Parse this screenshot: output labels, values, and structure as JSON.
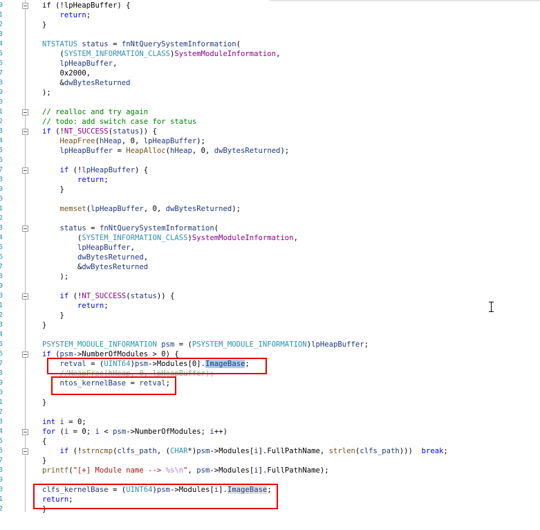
{
  "gutter_numbers": [
    "9",
    "1",
    "2",
    "3",
    "4",
    "5",
    "6",
    "7",
    "8",
    "9",
    "0",
    "1",
    "2",
    "3",
    "4",
    "5",
    "6",
    "7",
    "8",
    "9",
    "0",
    "1",
    "2",
    "3",
    "4",
    "5",
    "6",
    "7",
    "8",
    "9",
    "0",
    "1",
    "2",
    "3",
    "4",
    "5",
    "6",
    "7",
    "8",
    "9",
    "0",
    "1",
    "2",
    "3",
    "4",
    "5",
    "6",
    "7",
    "8",
    "9",
    "0",
    "1",
    "2"
  ],
  "colors": {
    "keyword": "#0000ff",
    "function": "#74531f",
    "variable": "#1f377f",
    "type": "#2b91af",
    "enum_member": "#8b008b",
    "comment": "#008000",
    "string": "#a31515",
    "selection_highlight": "#a8cde8",
    "annotation_box": "#e60000"
  },
  "code_lines": [
    [
      {
        "t": "if (!lpHeapBuffer) {",
        "c": "plain"
      }
    ],
    [
      {
        "t": "    ",
        "c": "plain"
      },
      {
        "t": "return",
        "c": "kw"
      },
      {
        "t": ";",
        "c": "plain"
      }
    ],
    [
      {
        "t": "}",
        "c": "plain"
      }
    ],
    [],
    [
      {
        "t": "NTSTATUS",
        "c": "type"
      },
      {
        "t": " ",
        "c": "plain"
      },
      {
        "t": "status",
        "c": "var"
      },
      {
        "t": " = ",
        "c": "plain"
      },
      {
        "t": "fnNtQuerySystemInformation",
        "c": "var"
      },
      {
        "t": "(",
        "c": "plain"
      }
    ],
    [
      {
        "t": "    (",
        "c": "plain"
      },
      {
        "t": "SYSTEM_INFORMATION_CLASS",
        "c": "type"
      },
      {
        "t": ")",
        "c": "plain"
      },
      {
        "t": "SystemModuleInformation",
        "c": "enum"
      },
      {
        "t": ",",
        "c": "plain"
      }
    ],
    [
      {
        "t": "    ",
        "c": "plain"
      },
      {
        "t": "lpHeapBuffer",
        "c": "var"
      },
      {
        "t": ",",
        "c": "plain"
      }
    ],
    [
      {
        "t": "    0x2000,",
        "c": "plain"
      }
    ],
    [
      {
        "t": "    &",
        "c": "plain"
      },
      {
        "t": "dwBytesReturned",
        "c": "var"
      }
    ],
    [
      {
        "t": ");",
        "c": "plain"
      }
    ],
    [],
    [
      {
        "t": "// realloc and try again",
        "c": "cm"
      }
    ],
    [
      {
        "t": "// todo: add switch case for status",
        "c": "cm"
      }
    ],
    [
      {
        "t": "if",
        "c": "kw"
      },
      {
        "t": " (!",
        "c": "plain"
      },
      {
        "t": "NT_SUCCESS",
        "c": "mac"
      },
      {
        "t": "(",
        "c": "plain"
      },
      {
        "t": "status",
        "c": "var"
      },
      {
        "t": ")) {",
        "c": "plain"
      }
    ],
    [
      {
        "t": "    ",
        "c": "plain"
      },
      {
        "t": "HeapFree",
        "c": "fn"
      },
      {
        "t": "(",
        "c": "plain"
      },
      {
        "t": "hHeap",
        "c": "var"
      },
      {
        "t": ", 0, ",
        "c": "plain"
      },
      {
        "t": "lpHeapBuffer",
        "c": "var"
      },
      {
        "t": ");",
        "c": "plain"
      }
    ],
    [
      {
        "t": "    ",
        "c": "plain"
      },
      {
        "t": "lpHeapBuffer",
        "c": "var"
      },
      {
        "t": " = ",
        "c": "plain"
      },
      {
        "t": "HeapAlloc",
        "c": "fn"
      },
      {
        "t": "(",
        "c": "plain"
      },
      {
        "t": "hHeap",
        "c": "var"
      },
      {
        "t": ", 0, ",
        "c": "plain"
      },
      {
        "t": "dwBytesReturned",
        "c": "var"
      },
      {
        "t": ");",
        "c": "plain"
      }
    ],
    [],
    [
      {
        "t": "    ",
        "c": "plain"
      },
      {
        "t": "if",
        "c": "kw"
      },
      {
        "t": " (!",
        "c": "plain"
      },
      {
        "t": "lpHeapBuffer",
        "c": "var"
      },
      {
        "t": ") {",
        "c": "plain"
      }
    ],
    [
      {
        "t": "        ",
        "c": "plain"
      },
      {
        "t": "return",
        "c": "kw"
      },
      {
        "t": ";",
        "c": "plain"
      }
    ],
    [
      {
        "t": "    }",
        "c": "plain"
      }
    ],
    [],
    [
      {
        "t": "    ",
        "c": "plain"
      },
      {
        "t": "memset",
        "c": "fn"
      },
      {
        "t": "(",
        "c": "plain"
      },
      {
        "t": "lpHeapBuffer",
        "c": "var"
      },
      {
        "t": ", 0, ",
        "c": "plain"
      },
      {
        "t": "dwBytesReturned",
        "c": "var"
      },
      {
        "t": ");",
        "c": "plain"
      }
    ],
    [],
    [
      {
        "t": "    ",
        "c": "plain"
      },
      {
        "t": "status",
        "c": "var"
      },
      {
        "t": " = ",
        "c": "plain"
      },
      {
        "t": "fnNtQuerySystemInformation",
        "c": "var"
      },
      {
        "t": "(",
        "c": "plain"
      }
    ],
    [
      {
        "t": "        (",
        "c": "plain"
      },
      {
        "t": "SYSTEM_INFORMATION_CLASS",
        "c": "type"
      },
      {
        "t": ")",
        "c": "plain"
      },
      {
        "t": "SystemModuleInformation",
        "c": "enum"
      },
      {
        "t": ",",
        "c": "plain"
      }
    ],
    [
      {
        "t": "        ",
        "c": "plain"
      },
      {
        "t": "lpHeapBuffer",
        "c": "var"
      },
      {
        "t": ",",
        "c": "plain"
      }
    ],
    [
      {
        "t": "        ",
        "c": "plain"
      },
      {
        "t": "dwBytesReturned",
        "c": "var"
      },
      {
        "t": ",",
        "c": "plain"
      }
    ],
    [
      {
        "t": "        &",
        "c": "plain"
      },
      {
        "t": "dwBytesReturned",
        "c": "var"
      }
    ],
    [
      {
        "t": "    );",
        "c": "plain"
      }
    ],
    [],
    [
      {
        "t": "    ",
        "c": "plain"
      },
      {
        "t": "if",
        "c": "kw"
      },
      {
        "t": " (!",
        "c": "plain"
      },
      {
        "t": "NT_SUCCESS",
        "c": "mac"
      },
      {
        "t": "(",
        "c": "plain"
      },
      {
        "t": "status",
        "c": "var"
      },
      {
        "t": ")) {",
        "c": "plain"
      }
    ],
    [
      {
        "t": "        ",
        "c": "plain"
      },
      {
        "t": "return",
        "c": "kw"
      },
      {
        "t": ";",
        "c": "plain"
      }
    ],
    [
      {
        "t": "    }",
        "c": "plain"
      }
    ],
    [
      {
        "t": "}",
        "c": "plain"
      }
    ],
    [],
    [
      {
        "t": "PSYSTEM_MODULE_INFORMATION",
        "c": "type"
      },
      {
        "t": " ",
        "c": "plain"
      },
      {
        "t": "psm",
        "c": "var"
      },
      {
        "t": " = (",
        "c": "plain"
      },
      {
        "t": "PSYSTEM_MODULE_INFORMATION",
        "c": "type"
      },
      {
        "t": ")",
        "c": "plain"
      },
      {
        "t": "lpHeapBuffer",
        "c": "var"
      },
      {
        "t": ";",
        "c": "plain"
      }
    ],
    [
      {
        "t": "if",
        "c": "kw"
      },
      {
        "t": " (",
        "c": "plain"
      },
      {
        "t": "psm",
        "c": "var"
      },
      {
        "t": "->NumberOfModules > 0) {",
        "c": "plain"
      }
    ],
    [
      {
        "t": "    ",
        "c": "plain"
      },
      {
        "t": "retval",
        "c": "var"
      },
      {
        "t": " = (",
        "c": "plain"
      },
      {
        "t": "UINT64",
        "c": "type"
      },
      {
        "t": ")",
        "c": "plain"
      },
      {
        "t": "psm",
        "c": "var"
      },
      {
        "t": "->Modules[0].",
        "c": "plain"
      },
      {
        "t": "ImageBase",
        "c": "hl"
      },
      {
        "t": ";",
        "c": "plain"
      }
    ],
    [
      {
        "t": "    //HeapFree(hHeap, 0, lpHeapBuffer);",
        "c": "strike"
      }
    ],
    [
      {
        "t": "    ",
        "c": "plain"
      },
      {
        "t": "ntos_kernelBase",
        "c": "var"
      },
      {
        "t": " = ",
        "c": "plain"
      },
      {
        "t": "retval",
        "c": "var"
      },
      {
        "t": ";",
        "c": "plain"
      }
    ],
    [],
    [
      {
        "t": "}",
        "c": "plain"
      }
    ],
    [],
    [
      {
        "t": "int",
        "c": "kw"
      },
      {
        "t": " ",
        "c": "plain"
      },
      {
        "t": "i",
        "c": "var"
      },
      {
        "t": " = 0;",
        "c": "plain"
      }
    ],
    [
      {
        "t": "for",
        "c": "kw"
      },
      {
        "t": " (",
        "c": "plain"
      },
      {
        "t": "i",
        "c": "var"
      },
      {
        "t": " = 0; ",
        "c": "plain"
      },
      {
        "t": "i",
        "c": "var"
      },
      {
        "t": " < ",
        "c": "plain"
      },
      {
        "t": "psm",
        "c": "var"
      },
      {
        "t": "->NumberOfModules; ",
        "c": "plain"
      },
      {
        "t": "i",
        "c": "var"
      },
      {
        "t": "++)",
        "c": "plain"
      }
    ],
    [
      {
        "t": "{",
        "c": "plain"
      }
    ],
    [
      {
        "t": "    ",
        "c": "plain"
      },
      {
        "t": "if",
        "c": "kw"
      },
      {
        "t": " (!",
        "c": "plain"
      },
      {
        "t": "strncmp",
        "c": "fn"
      },
      {
        "t": "(",
        "c": "plain"
      },
      {
        "t": "clfs_path",
        "c": "var"
      },
      {
        "t": ", (",
        "c": "plain"
      },
      {
        "t": "CHAR",
        "c": "type"
      },
      {
        "t": "*)",
        "c": "plain"
      },
      {
        "t": "psm",
        "c": "var"
      },
      {
        "t": "->Modules[",
        "c": "plain"
      },
      {
        "t": "i",
        "c": "var"
      },
      {
        "t": "].FullPathName, ",
        "c": "plain"
      },
      {
        "t": "strlen",
        "c": "fn"
      },
      {
        "t": "(",
        "c": "plain"
      },
      {
        "t": "clfs_path",
        "c": "var"
      },
      {
        "t": ")))  ",
        "c": "plain"
      },
      {
        "t": "break",
        "c": "kw"
      },
      {
        "t": ";",
        "c": "plain"
      }
    ],
    [
      {
        "t": "}",
        "c": "plain"
      }
    ],
    [
      {
        "t": "printf",
        "c": "fn"
      },
      {
        "t": "(",
        "c": "plain"
      },
      {
        "t": "\"[+] Module name --> ",
        "c": "str"
      },
      {
        "t": "%s\\n",
        "c": "esc"
      },
      {
        "t": "\"",
        "c": "str"
      },
      {
        "t": ", ",
        "c": "plain"
      },
      {
        "t": "psm",
        "c": "var"
      },
      {
        "t": "->Modules[",
        "c": "plain"
      },
      {
        "t": "i",
        "c": "var"
      },
      {
        "t": "].FullPathName);",
        "c": "plain"
      }
    ],
    [],
    [
      {
        "t": "clfs_kernelBase",
        "c": "var"
      },
      {
        "t": " = (",
        "c": "plain"
      },
      {
        "t": "UINT64",
        "c": "type"
      },
      {
        "t": ")",
        "c": "plain"
      },
      {
        "t": "psm",
        "c": "var"
      },
      {
        "t": "->Modules[",
        "c": "plain"
      },
      {
        "t": "i",
        "c": "var"
      },
      {
        "t": "].",
        "c": "plain"
      },
      {
        "t": "ImageBase",
        "c": "hl2"
      },
      {
        "t": ";",
        "c": "plain"
      }
    ],
    [
      {
        "t": "return",
        "c": "kw"
      },
      {
        "t": ";",
        "c": "plain"
      }
    ],
    [
      {
        "t": "}",
        "c": "plain"
      }
    ]
  ]
}
